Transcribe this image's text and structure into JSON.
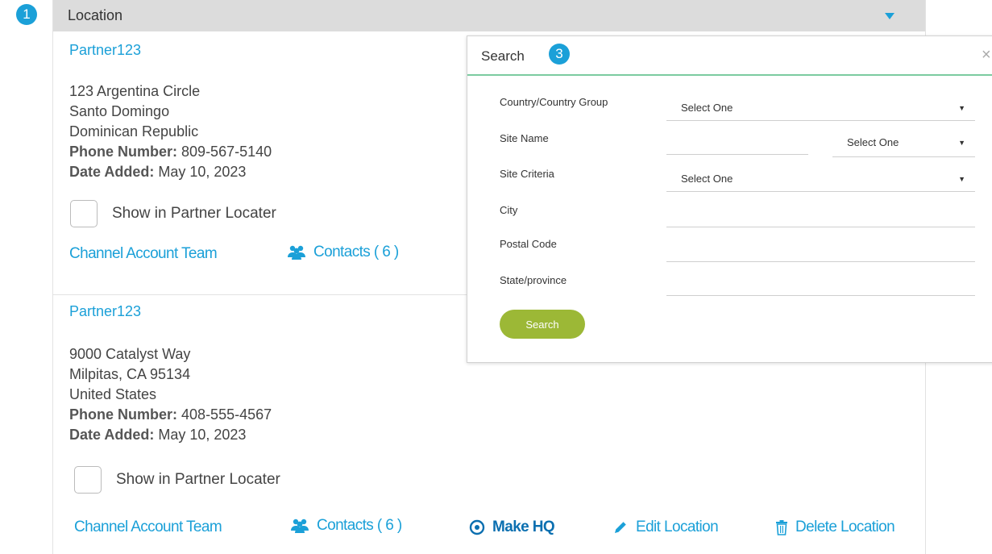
{
  "badges": {
    "panel": "1",
    "search": "3"
  },
  "panel": {
    "title": "Location"
  },
  "locations": [
    {
      "name": "Partner123",
      "address": [
        "123 Argentina Circle",
        "Santo Domingo",
        "Dominican Republic"
      ],
      "phone_label": "Phone Number:",
      "phone": "809-567-5140",
      "date_label": "Date Added:",
      "date": "May 10, 2023",
      "show_in_locator": "Show in Partner Locater",
      "channel_team": "Channel Account Team",
      "contacts": "Contacts ( 6 )"
    },
    {
      "name": "Partner123",
      "address": [
        "9000 Catalyst Way",
        "Milpitas, CA 95134",
        "United States"
      ],
      "phone_label": "Phone Number:",
      "phone": "408-555-4567",
      "date_label": "Date Added:",
      "date": "May 10, 2023",
      "show_in_locator": "Show in Partner Locater",
      "channel_team": "Channel Account Team",
      "contacts": "Contacts ( 6 )",
      "make_hq": "Make HQ",
      "edit": "Edit Location",
      "delete": "Delete Location"
    }
  ],
  "search_modal": {
    "title": "Search",
    "close": "×",
    "fields": {
      "country": {
        "label": "Country/Country Group",
        "value": "Select One"
      },
      "site_name": {
        "label": "Site Name",
        "value": "",
        "select_value": "Select One"
      },
      "site_criteria": {
        "label": "Site Criteria",
        "value": "Select One"
      },
      "city": {
        "label": "City",
        "value": ""
      },
      "postal": {
        "label": "Postal Code",
        "value": ""
      },
      "state": {
        "label": "State/province",
        "value": ""
      }
    },
    "button": "Search"
  },
  "colors": {
    "accent": "#1ba0d8",
    "link_dark": "#0b6fb0",
    "button": "#9cb836",
    "divider": "#7ccba0"
  }
}
